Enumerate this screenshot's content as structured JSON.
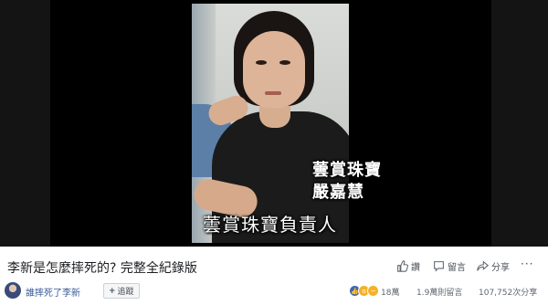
{
  "video": {
    "caption_name_line1": "蕓賞珠寶",
    "caption_name_line2": "嚴嘉慧",
    "caption_role": "蕓賞珠寶負責人"
  },
  "post": {
    "title": "李新是怎麼摔死的? 完整全紀錄版",
    "actions": {
      "like_label": "讚",
      "comment_label": "留言",
      "share_label": "分享"
    },
    "more_label": "···"
  },
  "page": {
    "name": "誰摔死了李新",
    "follow_label": "追蹤"
  },
  "stats": {
    "reactions_count": "18萬",
    "views": "1.9萬則留言",
    "shares": "107,752次分享"
  },
  "colors": {
    "link_blue": "#365899",
    "like_blue": "#4267b2",
    "text_dark": "#1c1e21",
    "text_gray": "#606770"
  }
}
